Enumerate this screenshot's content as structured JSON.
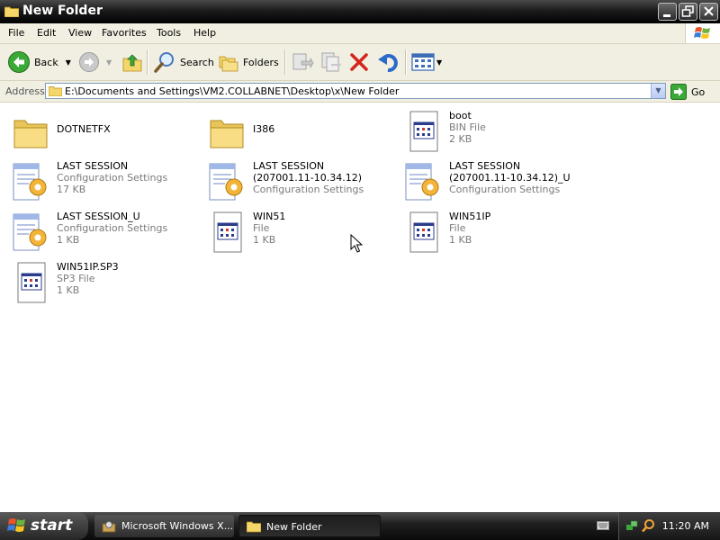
{
  "window": {
    "title": "New Folder",
    "controls": [
      "minimize",
      "maximize",
      "close"
    ]
  },
  "menu": [
    "File",
    "Edit",
    "View",
    "Favorites",
    "Tools",
    "Help"
  ],
  "toolbar": {
    "back": "Back",
    "search": "Search",
    "folders": "Folders"
  },
  "address": {
    "label": "Address",
    "path": "E:\\Documents and Settings\\VM2.COLLABNET\\Desktop\\x\\New Folder",
    "go": "Go"
  },
  "files": [
    {
      "name": "DOTNETFX",
      "type": "",
      "size": "",
      "icon": "folder-icon"
    },
    {
      "name": "I386",
      "type": "",
      "size": "",
      "icon": "folder-icon"
    },
    {
      "name": "boot",
      "type": "BIN File",
      "size": "2 KB",
      "icon": "file-icon"
    },
    {
      "name": "LAST SESSION",
      "name2": "",
      "type": "Configuration Settings",
      "size": "17 KB",
      "icon": "config-icon"
    },
    {
      "name": "LAST SESSION",
      "name2": "(207001.11-10.34.12)",
      "type": "Configuration Settings",
      "size": "",
      "icon": "config-icon"
    },
    {
      "name": "LAST SESSION",
      "name2": "(207001.11-10.34.12)_U",
      "type": "Configuration Settings",
      "size": "",
      "icon": "config-icon"
    },
    {
      "name": "LAST SESSION_U",
      "type": "Configuration Settings",
      "size": "1 KB",
      "icon": "config-icon"
    },
    {
      "name": "WIN51",
      "type": "File",
      "size": "1 KB",
      "icon": "file-icon"
    },
    {
      "name": "WIN51IP",
      "type": "File",
      "size": "1 KB",
      "icon": "file-icon"
    },
    {
      "name": "WIN51IP.SP3",
      "type": "SP3 File",
      "size": "1 KB",
      "icon": "file-icon"
    }
  ],
  "taskbar": {
    "start": "start",
    "items": [
      {
        "label": "Microsoft Windows X...",
        "icon": "installer-icon"
      },
      {
        "label": "New Folder",
        "icon": "folder-icon"
      }
    ],
    "clock": "11:20 AM"
  }
}
